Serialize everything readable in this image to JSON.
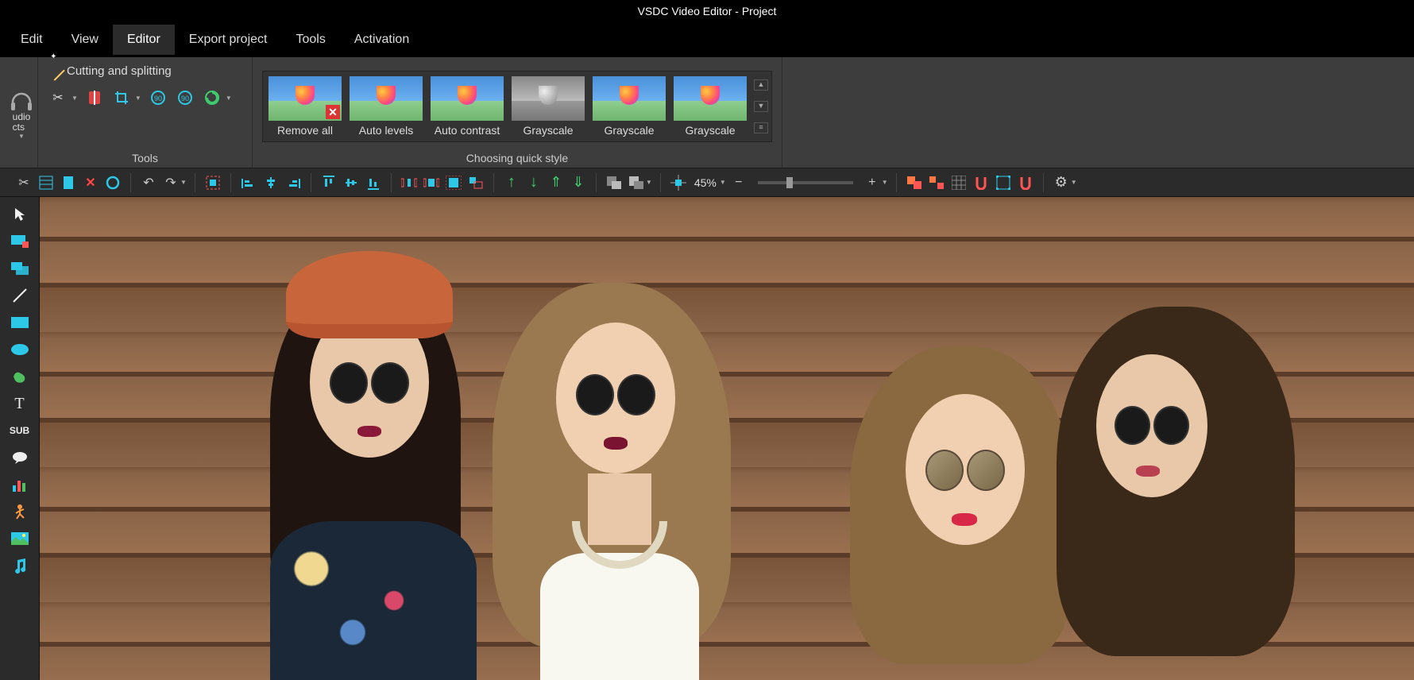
{
  "title": "VSDC Video Editor - Project",
  "menu": [
    "Edit",
    "View",
    "Editor",
    "Export project",
    "Tools",
    "Activation"
  ],
  "active_menu_index": 2,
  "ribbon": {
    "audio_label": "udio\ncts",
    "cutting_label": "Cutting and splitting",
    "tools_label": "Tools",
    "quick_style_label": "Choosing quick style",
    "styles": [
      {
        "label": "Remove all",
        "gray": false,
        "rx": true
      },
      {
        "label": "Auto levels",
        "gray": false,
        "rx": false
      },
      {
        "label": "Auto contrast",
        "gray": false,
        "rx": false
      },
      {
        "label": "Grayscale",
        "gray": true,
        "rx": false
      },
      {
        "label": "Grayscale",
        "gray": false,
        "rx": false
      },
      {
        "label": "Grayscale",
        "gray": false,
        "rx": false
      }
    ]
  },
  "toolbar": {
    "zoom": "45%"
  }
}
